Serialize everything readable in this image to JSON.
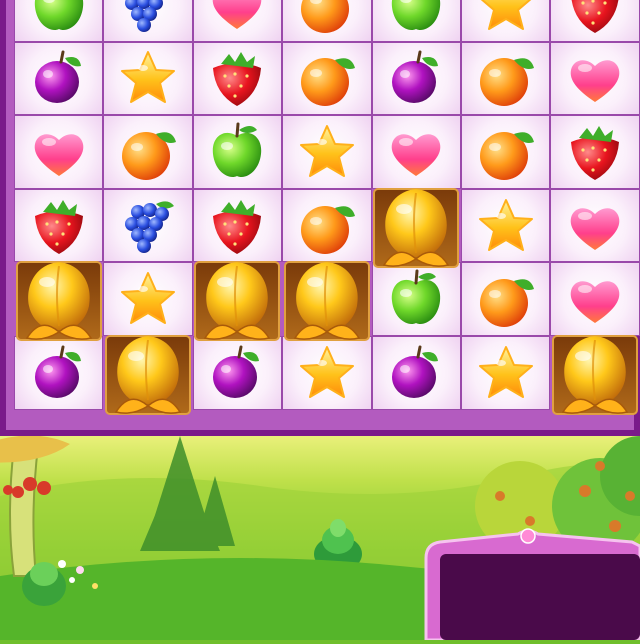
{
  "game": {
    "board": {
      "rows": [
        [
          "green-apple",
          "grapes",
          "heart-candy",
          "orange",
          "green-apple",
          "star-candy",
          "strawberry"
        ],
        [
          "plum",
          "star-candy",
          "strawberry",
          "orange",
          "plum",
          "orange",
          "heart-candy"
        ],
        [
          "heart-candy",
          "orange",
          "green-apple",
          "star-candy",
          "heart-candy",
          "orange",
          "strawberry"
        ],
        [
          "strawberry",
          "grapes",
          "strawberry",
          "orange",
          "golden-peach",
          "star-candy",
          "heart-candy"
        ],
        [
          "golden-peach",
          "star-candy",
          "golden-peach",
          "golden-peach",
          "green-apple",
          "orange",
          "heart-candy"
        ],
        [
          "plum",
          "golden-peach",
          "plum",
          "star-candy",
          "plum",
          "star-candy",
          "golden-peach"
        ]
      ]
    },
    "colors": {
      "board_frame": "#7a1a8a",
      "board_border": "#b35bbf",
      "panel_border": "#d86ad0",
      "panel_fill": "#4a0a4a"
    }
  }
}
